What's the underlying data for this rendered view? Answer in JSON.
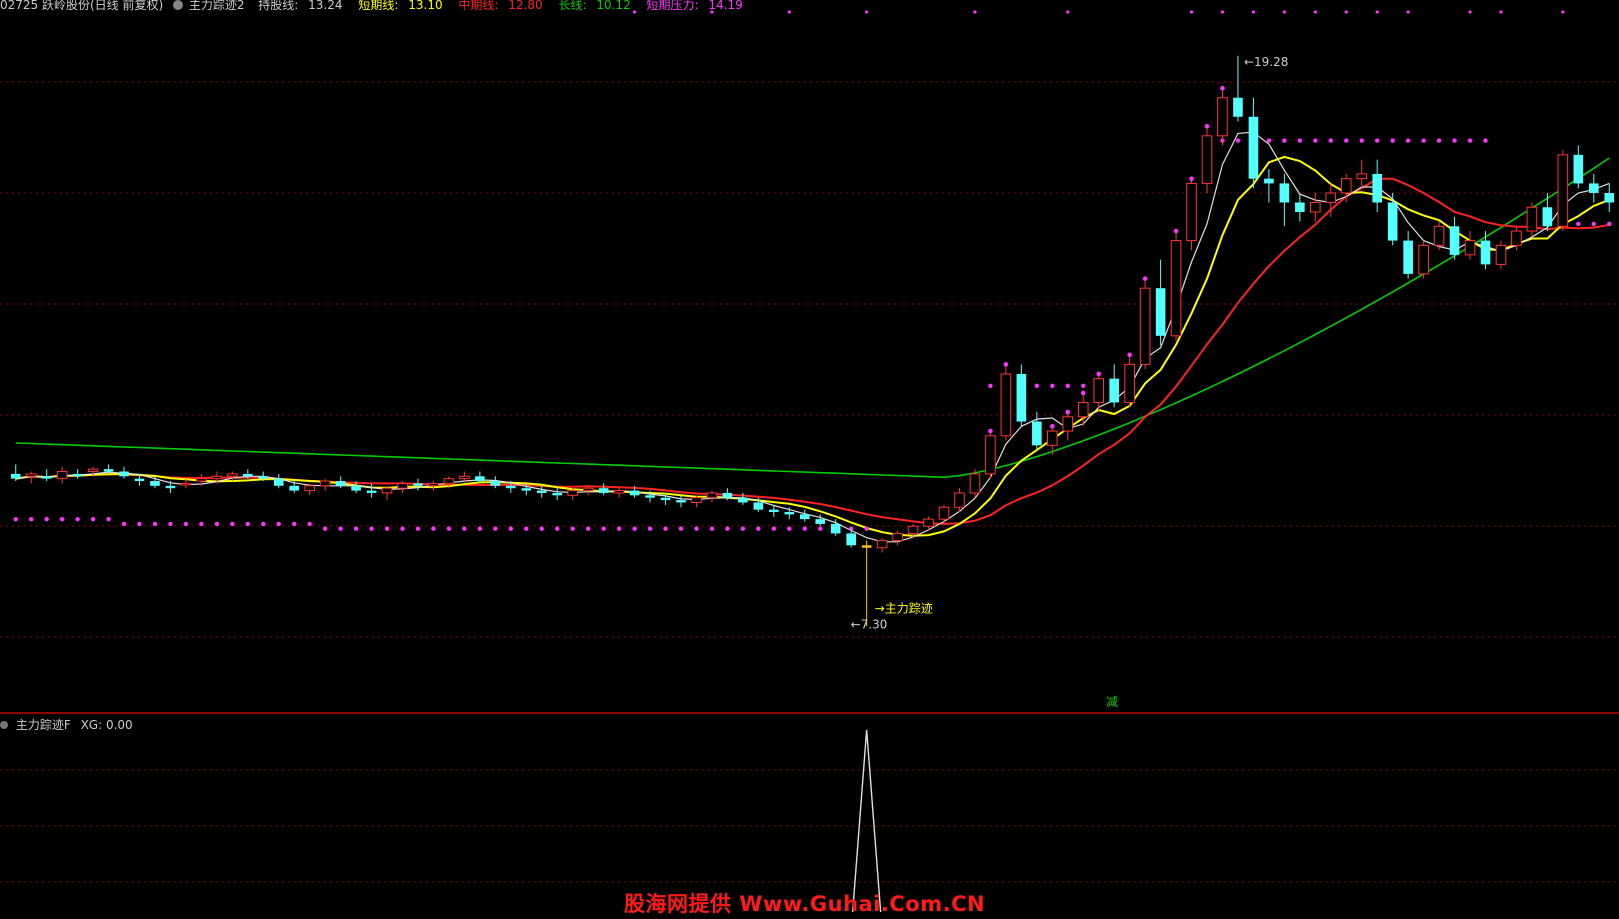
{
  "header": {
    "stock": "02725 跃岭股份(日线 前复权)",
    "indicator": "主力踪迹2",
    "items": [
      {
        "label": "持股线:",
        "value": "13.24",
        "color": "#cccccc"
      },
      {
        "label": "短期线:",
        "value": "13.10",
        "color": "#ffff00"
      },
      {
        "label": "中期线:",
        "value": "12.80",
        "color": "#ff2222"
      },
      {
        "label": "长线:",
        "value": "10.12",
        "color": "#00cc00"
      },
      {
        "label": "短期压力:",
        "value": "14.19",
        "color": "#ff33ff"
      }
    ]
  },
  "sub_panel": {
    "label": "主力踪迹F",
    "xg_label": "XG:",
    "xg_value": "0.00"
  },
  "watermark": "股海网提供 Www.Guhai.Com.CN",
  "colors": {
    "up": "#ff3333",
    "down": "#54ffff",
    "hold_line": "#e0e0e0",
    "short_line": "#ffff00",
    "mid_line": "#ff2222",
    "long_line": "#00cc00",
    "pressure": "#ff33ff",
    "signal": "#ffcc00",
    "grid": "#8b0000"
  },
  "chart_data": {
    "type": "candlestick",
    "price_range": [
      5.5,
      20.2
    ],
    "annotations": {
      "high_label": "19.28",
      "low_label": "7.30",
      "signal_label": "主力踪迹",
      "reduce_label": "减"
    },
    "candles": [
      [
        10.5,
        10.7,
        10.35,
        10.4
      ],
      [
        10.45,
        10.55,
        10.3,
        10.5
      ],
      [
        10.45,
        10.6,
        10.35,
        10.4
      ],
      [
        10.4,
        10.65,
        10.3,
        10.55
      ],
      [
        10.5,
        10.6,
        10.4,
        10.45
      ],
      [
        10.55,
        10.65,
        10.45,
        10.6
      ],
      [
        10.6,
        10.7,
        10.5,
        10.55
      ],
      [
        10.55,
        10.65,
        10.4,
        10.45
      ],
      [
        10.4,
        10.5,
        10.25,
        10.35
      ],
      [
        10.35,
        10.45,
        10.2,
        10.25
      ],
      [
        10.25,
        10.35,
        10.1,
        10.2
      ],
      [
        10.3,
        10.4,
        10.2,
        10.3
      ],
      [
        10.35,
        10.5,
        10.25,
        10.4
      ],
      [
        10.4,
        10.55,
        10.3,
        10.45
      ],
      [
        10.45,
        10.55,
        10.35,
        10.5
      ],
      [
        10.5,
        10.6,
        10.4,
        10.45
      ],
      [
        10.45,
        10.55,
        10.35,
        10.4
      ],
      [
        10.4,
        10.5,
        10.2,
        10.25
      ],
      [
        10.25,
        10.35,
        10.1,
        10.15
      ],
      [
        10.15,
        10.3,
        10.05,
        10.25
      ],
      [
        10.25,
        10.4,
        10.15,
        10.35
      ],
      [
        10.35,
        10.45,
        10.2,
        10.25
      ],
      [
        10.25,
        10.35,
        10.1,
        10.15
      ],
      [
        10.15,
        10.3,
        10.0,
        10.1
      ],
      [
        10.1,
        10.25,
        9.95,
        10.2
      ],
      [
        10.2,
        10.35,
        10.1,
        10.3
      ],
      [
        10.3,
        10.4,
        10.15,
        10.25
      ],
      [
        10.25,
        10.35,
        10.15,
        10.3
      ],
      [
        10.3,
        10.45,
        10.2,
        10.4
      ],
      [
        10.4,
        10.55,
        10.3,
        10.45
      ],
      [
        10.45,
        10.55,
        10.3,
        10.35
      ],
      [
        10.35,
        10.45,
        10.2,
        10.25
      ],
      [
        10.25,
        10.35,
        10.1,
        10.2
      ],
      [
        10.2,
        10.3,
        10.05,
        10.15
      ],
      [
        10.15,
        10.25,
        10.0,
        10.1
      ],
      [
        10.1,
        10.2,
        9.95,
        10.05
      ],
      [
        10.05,
        10.2,
        9.95,
        10.15
      ],
      [
        10.15,
        10.25,
        10.05,
        10.2
      ],
      [
        10.2,
        10.3,
        10.05,
        10.1
      ],
      [
        10.1,
        10.2,
        10.0,
        10.15
      ],
      [
        10.15,
        10.25,
        10.0,
        10.05
      ],
      [
        10.05,
        10.15,
        9.9,
        10.0
      ],
      [
        10.0,
        10.1,
        9.85,
        9.95
      ],
      [
        9.95,
        10.05,
        9.8,
        9.9
      ],
      [
        9.9,
        10.05,
        9.8,
        10.0
      ],
      [
        10.0,
        10.15,
        9.9,
        10.1
      ],
      [
        10.1,
        10.2,
        9.95,
        10.0
      ],
      [
        10.0,
        10.1,
        9.85,
        9.9
      ],
      [
        9.9,
        10.0,
        9.7,
        9.75
      ],
      [
        9.75,
        9.85,
        9.6,
        9.7
      ],
      [
        9.7,
        9.8,
        9.55,
        9.65
      ],
      [
        9.65,
        9.75,
        9.5,
        9.55
      ],
      [
        9.55,
        9.65,
        9.4,
        9.45
      ],
      [
        9.45,
        9.55,
        9.2,
        9.25
      ],
      [
        9.25,
        9.35,
        8.95,
        9.0
      ],
      [
        9.0,
        9.1,
        7.3,
        8.95
      ],
      [
        8.95,
        9.15,
        8.85,
        9.1
      ],
      [
        9.1,
        9.3,
        9.0,
        9.25
      ],
      [
        9.25,
        9.45,
        9.15,
        9.4
      ],
      [
        9.4,
        9.6,
        9.3,
        9.55
      ],
      [
        9.55,
        9.85,
        9.45,
        9.8
      ],
      [
        9.8,
        10.2,
        9.7,
        10.1
      ],
      [
        10.1,
        10.6,
        10.0,
        10.5
      ],
      [
        10.5,
        11.4,
        10.4,
        11.3
      ],
      [
        11.3,
        12.8,
        11.2,
        12.6
      ],
      [
        12.6,
        12.8,
        11.5,
        11.6
      ],
      [
        11.6,
        11.8,
        11.0,
        11.1
      ],
      [
        11.1,
        11.5,
        10.9,
        11.4
      ],
      [
        11.4,
        11.8,
        11.2,
        11.7
      ],
      [
        11.7,
        12.2,
        11.5,
        12.0
      ],
      [
        12.0,
        12.6,
        11.8,
        12.5
      ],
      [
        12.5,
        12.8,
        11.9,
        12.0
      ],
      [
        12.0,
        13.0,
        11.9,
        12.8
      ],
      [
        12.8,
        14.6,
        12.7,
        14.4
      ],
      [
        14.4,
        15.0,
        13.2,
        13.4
      ],
      [
        13.4,
        15.6,
        13.3,
        15.4
      ],
      [
        15.4,
        16.7,
        15.2,
        16.6
      ],
      [
        16.6,
        17.8,
        16.4,
        17.6
      ],
      [
        17.6,
        18.6,
        17.4,
        18.4
      ],
      [
        18.4,
        19.28,
        17.9,
        18.0
      ],
      [
        18.0,
        18.4,
        16.5,
        16.7
      ],
      [
        16.7,
        16.9,
        16.2,
        16.6
      ],
      [
        16.6,
        16.8,
        15.7,
        16.2
      ],
      [
        16.2,
        16.4,
        15.8,
        16.0
      ],
      [
        16.0,
        16.4,
        15.8,
        16.2
      ],
      [
        16.2,
        16.6,
        15.9,
        16.4
      ],
      [
        16.4,
        16.8,
        16.2,
        16.7
      ],
      [
        16.7,
        17.1,
        16.5,
        16.8
      ],
      [
        16.8,
        17.1,
        16.0,
        16.2
      ],
      [
        16.2,
        16.4,
        15.3,
        15.4
      ],
      [
        15.4,
        15.6,
        14.6,
        14.7
      ],
      [
        14.7,
        15.4,
        14.6,
        15.3
      ],
      [
        15.3,
        15.8,
        15.2,
        15.7
      ],
      [
        15.7,
        15.9,
        15.0,
        15.1
      ],
      [
        15.1,
        15.6,
        15.0,
        15.4
      ],
      [
        15.4,
        15.6,
        14.8,
        14.9
      ],
      [
        14.9,
        15.4,
        14.8,
        15.3
      ],
      [
        15.3,
        15.7,
        15.2,
        15.6
      ],
      [
        15.6,
        16.2,
        15.5,
        16.1
      ],
      [
        16.1,
        16.4,
        15.6,
        15.7
      ],
      [
        15.7,
        17.3,
        15.6,
        17.2
      ],
      [
        17.2,
        17.4,
        16.5,
        16.6
      ],
      [
        16.6,
        16.8,
        16.2,
        16.4
      ],
      [
        16.4,
        16.6,
        16.0,
        16.2
      ]
    ],
    "short_pressure_levels": [
      {
        "from": 0,
        "to": 6,
        "value": 9.55
      },
      {
        "from": 7,
        "to": 19,
        "value": 9.45
      },
      {
        "from": 20,
        "to": 55,
        "value": 9.35
      },
      {
        "from": 63,
        "to": 70,
        "value": 12.35
      },
      {
        "from": 77,
        "to": 95,
        "value": 17.5
      },
      {
        "from": 100,
        "to": 103,
        "value": 15.75
      }
    ],
    "signal_index": 55,
    "sub_peak_index": 55
  }
}
